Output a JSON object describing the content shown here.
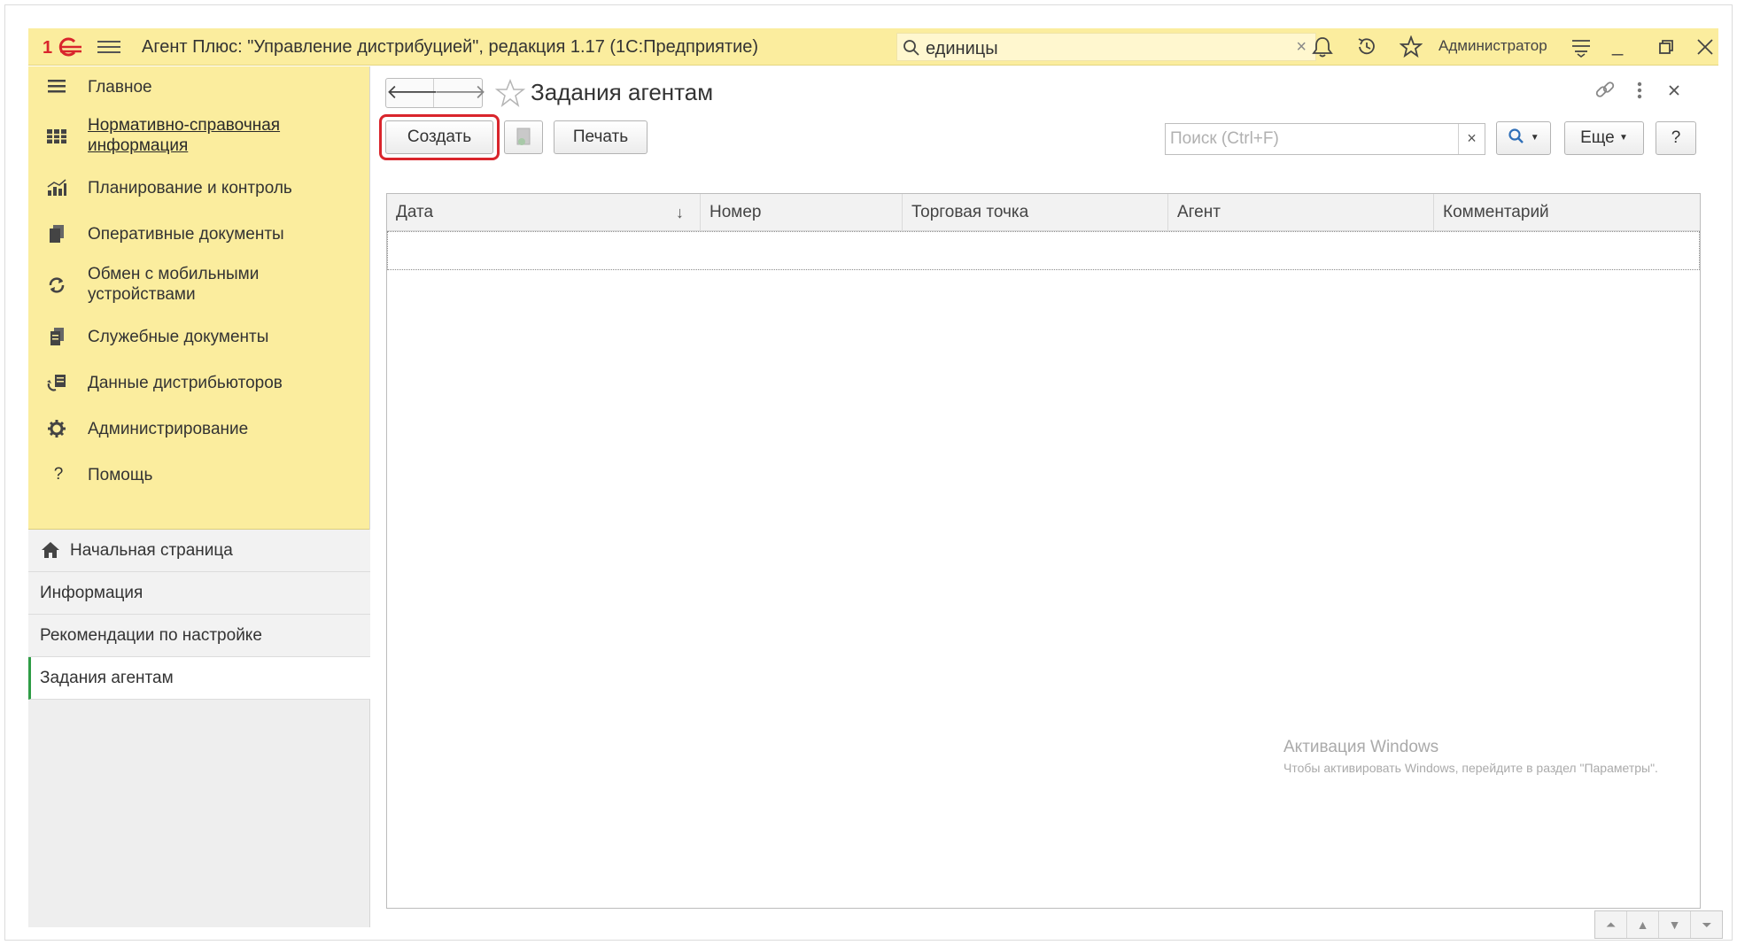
{
  "titlebar": {
    "app_title": "Агент Плюс: \"Управление дистрибуцией\", редакция 1.17  (1С:Предприятие)",
    "search_value": "единицы",
    "user": "Администратор",
    "logo_text": "1С"
  },
  "sidebar": {
    "sections": [
      {
        "label": "Главное",
        "icon": "menu-lines-icon"
      },
      {
        "label": "Нормативно-справочная информация",
        "icon": "grid-icon"
      },
      {
        "label": "Планирование и контроль",
        "icon": "bar-chart-icon"
      },
      {
        "label": "Оперативные документы",
        "icon": "documents-icon"
      },
      {
        "label": "Обмен с мобильными устройствами",
        "icon": "sync-icon"
      },
      {
        "label": "Служебные документы",
        "icon": "service-docs-icon"
      },
      {
        "label": "Данные дистрибьюторов",
        "icon": "distributor-data-icon"
      },
      {
        "label": "Администрирование",
        "icon": "gear-icon"
      },
      {
        "label": "Помощь",
        "icon": "question-icon"
      }
    ],
    "open_windows": [
      {
        "label": "Начальная страница",
        "icon": "home-icon"
      },
      {
        "label": "Информация"
      },
      {
        "label": "Рекомендации по настройке"
      },
      {
        "label": "Задания агентам",
        "active": true
      }
    ]
  },
  "form": {
    "title": "Задания агентам",
    "toolbar": {
      "create_label": "Создать",
      "print_label": "Печать",
      "search_placeholder": "Поиск (Ctrl+F)",
      "search_clear": "×",
      "more_label": "Еще",
      "help_label": "?"
    },
    "table": {
      "columns": [
        "Дата",
        "Номер",
        "Торговая точка",
        "Агент",
        "Комментарий"
      ],
      "sort_indicator": "↓",
      "rows": []
    }
  },
  "watermark": {
    "line1": "Активация Windows",
    "line2": "Чтобы активировать Windows, перейдите в раздел \"Параметры\"."
  },
  "colors": {
    "accent_yellow": "#fbed9e",
    "logo_red": "#d9252c",
    "active_green": "#2e9c45",
    "highlight_red": "#d9252c"
  }
}
